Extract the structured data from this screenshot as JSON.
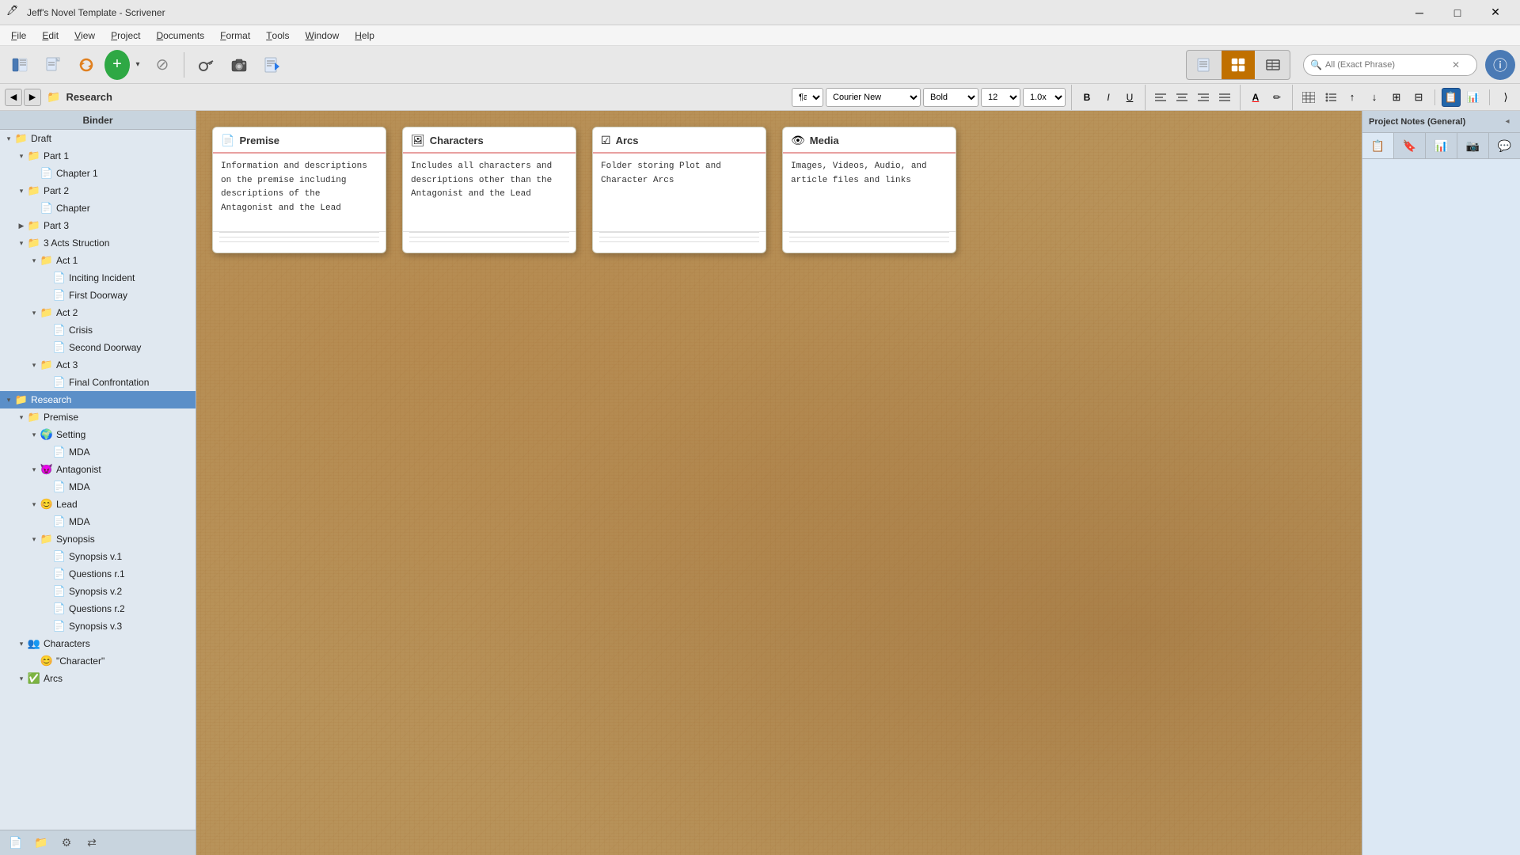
{
  "window": {
    "title": "Jeff's Novel Template - Scrivener"
  },
  "titlebar": {
    "title": "Jeff's Novel Template - Scrivener",
    "min": "─",
    "max": "□",
    "close": "✕"
  },
  "menubar": {
    "items": [
      {
        "label": "File",
        "underline": "F"
      },
      {
        "label": "Edit",
        "underline": "E"
      },
      {
        "label": "View",
        "underline": "V"
      },
      {
        "label": "Project",
        "underline": "P"
      },
      {
        "label": "Documents",
        "underline": "D"
      },
      {
        "label": "Format",
        "underline": "F"
      },
      {
        "label": "Tools",
        "underline": "T"
      },
      {
        "label": "Window",
        "underline": "W"
      },
      {
        "label": "Help",
        "underline": "H"
      }
    ]
  },
  "toolbar": {
    "view_buttons": [
      {
        "id": "single-doc",
        "icon": "▤",
        "label": "Single Document View",
        "active": false
      },
      {
        "id": "scrivenings",
        "icon": "▦",
        "label": "Scrivenings View",
        "active": true
      },
      {
        "id": "corkboard",
        "icon": "⊞",
        "label": "Corkboard View",
        "active": false
      }
    ],
    "search": {
      "placeholder": "All (Exact Phrase)",
      "icon": "🔍"
    }
  },
  "format_toolbar": {
    "style_selector": "¶a",
    "font": "Courier New",
    "weight": "Bold",
    "size": "12",
    "spacing": "1.0x",
    "bold": "B",
    "italic": "I",
    "underline": "U",
    "align_left": "≡",
    "align_center": "≡",
    "align_right": "≡",
    "align_justify": "≡",
    "text_color": "A",
    "highlight": "✏",
    "table": "⊞",
    "list": "☰"
  },
  "nav": {
    "back": "◀",
    "forward": "▶",
    "breadcrumb": "Research",
    "breadcrumb_icon": "📁"
  },
  "binder": {
    "header": "Binder",
    "tree": [
      {
        "level": 0,
        "label": "Draft",
        "icon": "📁",
        "toggle": "▾",
        "id": "draft",
        "selected": false
      },
      {
        "level": 1,
        "label": "Part 1",
        "icon": "📁",
        "toggle": "▾",
        "id": "part1",
        "selected": false
      },
      {
        "level": 2,
        "label": "Chapter 1",
        "icon": "📄",
        "toggle": "",
        "id": "chapter1",
        "selected": false
      },
      {
        "level": 1,
        "label": "Part 2",
        "icon": "📁",
        "toggle": "▾",
        "id": "part2",
        "selected": false
      },
      {
        "level": 2,
        "label": "Chapter",
        "icon": "📄",
        "toggle": "",
        "id": "chapter",
        "selected": false
      },
      {
        "level": 1,
        "label": "Part 3",
        "icon": "📁",
        "toggle": "▶",
        "id": "part3",
        "selected": false
      },
      {
        "level": 1,
        "label": "3 Acts Struction",
        "icon": "📁",
        "toggle": "▾",
        "id": "3acts",
        "selected": false
      },
      {
        "level": 2,
        "label": "Act 1",
        "icon": "📁",
        "toggle": "▾",
        "id": "act1",
        "selected": false
      },
      {
        "level": 3,
        "label": "Inciting Incident",
        "icon": "📄",
        "toggle": "",
        "id": "inciting",
        "selected": false
      },
      {
        "level": 3,
        "label": "First Doorway",
        "icon": "📄",
        "toggle": "",
        "id": "first-doorway",
        "selected": false
      },
      {
        "level": 2,
        "label": "Act 2",
        "icon": "📁",
        "toggle": "▾",
        "id": "act2",
        "selected": false
      },
      {
        "level": 3,
        "label": "Crisis",
        "icon": "📄",
        "toggle": "",
        "id": "crisis",
        "selected": false
      },
      {
        "level": 3,
        "label": "Second Doorway",
        "icon": "📄",
        "toggle": "",
        "id": "second-doorway",
        "selected": false
      },
      {
        "level": 2,
        "label": "Act 3",
        "icon": "📁",
        "toggle": "▾",
        "id": "act3",
        "selected": false
      },
      {
        "level": 3,
        "label": "Final Confrontation",
        "icon": "📄",
        "toggle": "",
        "id": "final-confrontation",
        "selected": false
      },
      {
        "level": 0,
        "label": "Research",
        "icon": "📁",
        "toggle": "▾",
        "id": "research",
        "selected": true
      },
      {
        "level": 1,
        "label": "Premise",
        "icon": "📁",
        "toggle": "▾",
        "id": "premise",
        "selected": false
      },
      {
        "level": 2,
        "label": "Setting",
        "icon": "🌍",
        "toggle": "▾",
        "id": "setting",
        "selected": false
      },
      {
        "level": 3,
        "label": "MDA",
        "icon": "📄",
        "toggle": "",
        "id": "mda-setting",
        "selected": false
      },
      {
        "level": 2,
        "label": "Antagonist",
        "icon": "😈",
        "toggle": "▾",
        "id": "antagonist",
        "selected": false
      },
      {
        "level": 3,
        "label": "MDA",
        "icon": "📄",
        "toggle": "",
        "id": "mda-antagonist",
        "selected": false
      },
      {
        "level": 2,
        "label": "Lead",
        "icon": "😊",
        "toggle": "▾",
        "id": "lead",
        "selected": false
      },
      {
        "level": 3,
        "label": "MDA",
        "icon": "📄",
        "toggle": "",
        "id": "mda-lead",
        "selected": false
      },
      {
        "level": 2,
        "label": "Synopsis",
        "icon": "📁",
        "toggle": "▾",
        "id": "synopsis",
        "selected": false
      },
      {
        "level": 3,
        "label": "Synopsis v.1",
        "icon": "📄",
        "toggle": "",
        "id": "synopsis-v1",
        "selected": false
      },
      {
        "level": 3,
        "label": "Questions r.1",
        "icon": "📄",
        "toggle": "",
        "id": "questions-r1",
        "selected": false
      },
      {
        "level": 3,
        "label": "Synopsis v.2",
        "icon": "📄",
        "toggle": "",
        "id": "synopsis-v2",
        "selected": false
      },
      {
        "level": 3,
        "label": "Questions r.2",
        "icon": "📄",
        "toggle": "",
        "id": "questions-r2",
        "selected": false
      },
      {
        "level": 3,
        "label": "Synopsis v.3",
        "icon": "📄",
        "toggle": "",
        "id": "synopsis-v3",
        "selected": false
      },
      {
        "level": 1,
        "label": "Characters",
        "icon": "👥",
        "toggle": "▾",
        "id": "characters",
        "selected": false
      },
      {
        "level": 2,
        "label": "\"Character\"",
        "icon": "😊",
        "toggle": "",
        "id": "character-template",
        "selected": false
      },
      {
        "level": 1,
        "label": "Arcs",
        "icon": "✅",
        "toggle": "▾",
        "id": "arcs",
        "selected": false
      }
    ],
    "footer_buttons": [
      {
        "id": "add-doc",
        "icon": "📄",
        "label": "Add Document"
      },
      {
        "id": "add-folder",
        "icon": "📁",
        "label": "Add Folder"
      },
      {
        "id": "settings",
        "icon": "⚙",
        "label": "Settings"
      },
      {
        "id": "arrows",
        "icon": "⇄",
        "label": "Navigation"
      }
    ]
  },
  "cards": [
    {
      "id": "premise-card",
      "icon": "📄",
      "title": "Premise",
      "body": "Information and\ndescriptions on the premise\nincluding descriptions of\nthe Antagonist and the Lead",
      "header_color": "#e8a0a0"
    },
    {
      "id": "characters-card",
      "icon": "🖼",
      "title": "Characters",
      "body": "Includes all characters and\ndescriptions other than the\nAntagonist and the Lead",
      "header_color": "#e8a0a0"
    },
    {
      "id": "arcs-card",
      "icon": "☑",
      "title": "Arcs",
      "body": "Folder storing Plot and\nCharacter Arcs",
      "header_color": "#e8a0a0"
    },
    {
      "id": "media-card",
      "icon": "👁",
      "title": "Media",
      "body": "Images, Videos, Audio, and\narticle files and links",
      "header_color": "#e8a0a0"
    }
  ],
  "right_panel": {
    "header": "Project Notes (General)",
    "toggle_icon": "◂"
  },
  "inspector": {
    "icon1": "📋",
    "icon2": "📊"
  },
  "bottom_bar": {
    "icon1": "📄",
    "icon2": "⊞"
  }
}
